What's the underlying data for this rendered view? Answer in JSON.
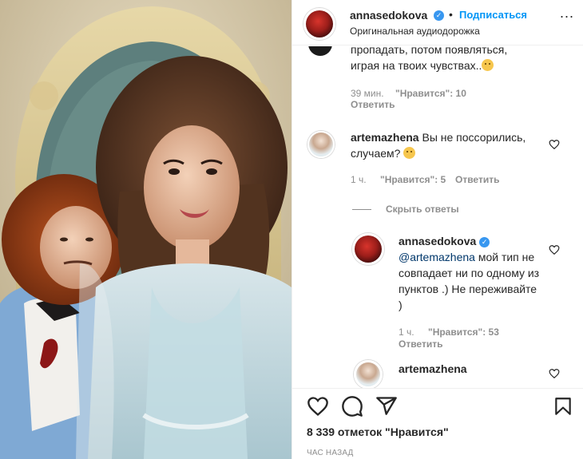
{
  "post": {
    "author": "annasedokova",
    "separator": "•",
    "follow_label": "Подписаться",
    "more_label": "...",
    "audio": "Оригинальная аудиодорожка"
  },
  "comments": {
    "c1": {
      "text": "пропадать, потом появляться, играя на твоих чувствах..",
      "time": "39 мин.",
      "likes_label": "\"Нравится\": 10",
      "reply_label": "Ответить"
    },
    "c2": {
      "author": "artemazhena",
      "text": "Вы не поссорились, случаем?",
      "time": "1 ч.",
      "likes_label": "\"Нравится\": 5",
      "reply_label": "Ответить"
    },
    "hide_replies": "Скрыть ответы",
    "r1": {
      "author": "annasedokova",
      "mention": "@artemazhena",
      "text": "мой тип не совпадает ни по одному из пунктов .) Не переживайте )",
      "time": "1 ч.",
      "likes_label": "\"Нравится\": 53",
      "reply_label": "Ответить"
    },
    "r2": {
      "author": "artemazhena"
    }
  },
  "footer": {
    "likes": "8 339 отметок \"Нравится\"",
    "posted": "ЧАС НАЗАД"
  },
  "icons": {
    "like": "heart-icon",
    "comment": "comment-icon",
    "share": "paper-plane-icon",
    "save": "bookmark-icon",
    "verified": "verified-badge-icon"
  },
  "colors": {
    "accent": "#0095f6",
    "verified": "#3897f0",
    "muted": "#8e8e8e",
    "text": "#262626"
  }
}
